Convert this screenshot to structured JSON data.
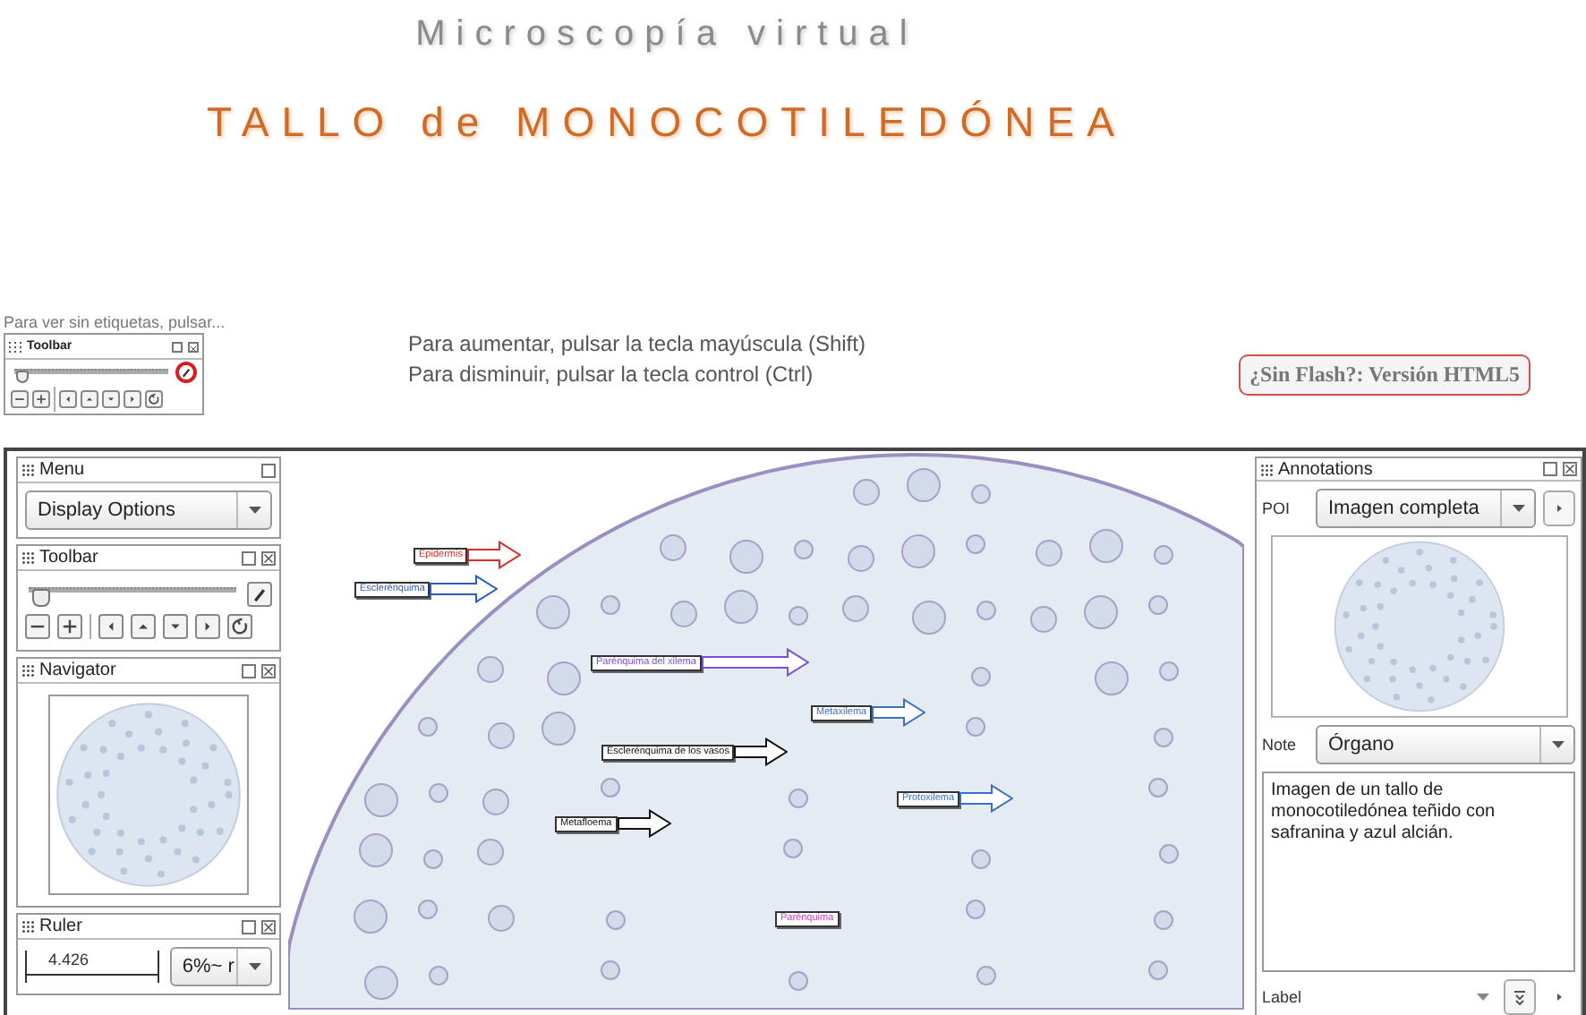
{
  "header": {
    "title": "Microscopía virtual",
    "subtitle": "TALLO de MONOCOTILEDÓNEA"
  },
  "hint": "Para ver sin etiquetas, pulsar...",
  "mini_toolbar": {
    "title": "Toolbar",
    "level": 0.03,
    "highlighted": true
  },
  "instructions": [
    "Para aumentar, pulsar la tecla mayúscula (Shift)",
    "Para disminuir, pulsar la tecla control (Ctrl)"
  ],
  "html5_link": "¿Sin Flash?: Versión HTML5",
  "viewer": {
    "menu": {
      "title": "Menu",
      "closable": false,
      "dropdown": "Display Options"
    },
    "toolbar": {
      "title": "Toolbar",
      "closable": true,
      "level": 0.03
    },
    "navigator": {
      "title": "Navigator",
      "closable": true
    },
    "ruler": {
      "title": "Ruler",
      "closable": true,
      "reading": "4.426",
      "zoom": "6%~ r"
    },
    "labels": [
      {
        "text": "Epidermis",
        "color": "#d0302a",
        "arrow": true
      },
      {
        "text": "Esclerénquima",
        "color": "#2a5cc0",
        "arrow": true
      },
      {
        "text": "Parénquima del xilema",
        "color": "#7a4fd0",
        "arrow": true
      },
      {
        "text": "Metaxilema",
        "color": "#3a6fc8",
        "arrow": true
      },
      {
        "text": "Esclerénquima de los vasos",
        "color": "#111111",
        "arrow": true
      },
      {
        "text": "Protoxilema",
        "color": "#3a6fc8",
        "arrow": true
      },
      {
        "text": "Metafloema",
        "color": "#111111",
        "arrow": true
      },
      {
        "text": "Parénquima",
        "color": "#d040c0",
        "arrow": false
      }
    ],
    "annotations": {
      "title": "Annotations",
      "closable": true,
      "poi_label": "POI",
      "poi": "Imagen completa",
      "note_label": "Note",
      "note": "Órgano",
      "text": "Imagen de un tallo de monocotiledónea teñido con safranina y azul alcián.",
      "label_label": "Label"
    }
  }
}
